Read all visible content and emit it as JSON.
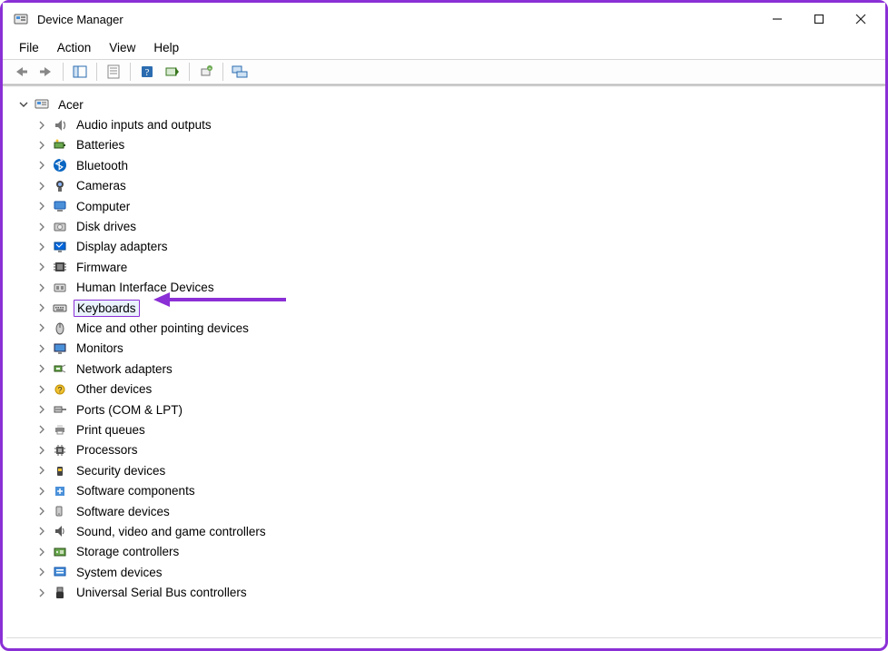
{
  "window": {
    "title": "Device Manager"
  },
  "menubar": {
    "file": "File",
    "action": "Action",
    "view": "View",
    "help": "Help"
  },
  "tree": {
    "root": {
      "label": "Acer"
    },
    "items": [
      {
        "label": "Audio inputs and outputs",
        "icon": "audio"
      },
      {
        "label": "Batteries",
        "icon": "battery"
      },
      {
        "label": "Bluetooth",
        "icon": "bluetooth"
      },
      {
        "label": "Cameras",
        "icon": "camera"
      },
      {
        "label": "Computer",
        "icon": "computer"
      },
      {
        "label": "Disk drives",
        "icon": "disk"
      },
      {
        "label": "Display adapters",
        "icon": "display"
      },
      {
        "label": "Firmware",
        "icon": "firmware"
      },
      {
        "label": "Human Interface Devices",
        "icon": "hid"
      },
      {
        "label": "Keyboards",
        "icon": "keyboard",
        "selected": true
      },
      {
        "label": "Mice and other pointing devices",
        "icon": "mouse"
      },
      {
        "label": "Monitors",
        "icon": "monitor"
      },
      {
        "label": "Network adapters",
        "icon": "network"
      },
      {
        "label": "Other devices",
        "icon": "other"
      },
      {
        "label": "Ports (COM & LPT)",
        "icon": "ports"
      },
      {
        "label": "Print queues",
        "icon": "printer"
      },
      {
        "label": "Processors",
        "icon": "cpu"
      },
      {
        "label": "Security devices",
        "icon": "security"
      },
      {
        "label": "Software components",
        "icon": "swcomp"
      },
      {
        "label": "Software devices",
        "icon": "swdev"
      },
      {
        "label": "Sound, video and game controllers",
        "icon": "sound"
      },
      {
        "label": "Storage controllers",
        "icon": "storage"
      },
      {
        "label": "System devices",
        "icon": "system"
      },
      {
        "label": "Universal Serial Bus controllers",
        "icon": "usb"
      }
    ]
  },
  "annotation": {
    "highlight_item": "Keyboards"
  }
}
